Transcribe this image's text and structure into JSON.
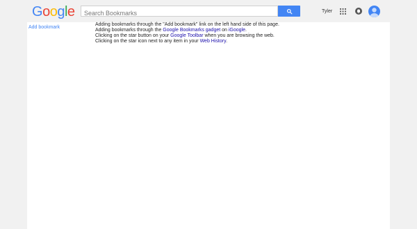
{
  "header": {
    "logo_letters": [
      {
        "ch": "G",
        "color": "#4285f4"
      },
      {
        "ch": "o",
        "color": "#ea4335"
      },
      {
        "ch": "o",
        "color": "#fbbc05"
      },
      {
        "ch": "g",
        "color": "#4285f4"
      },
      {
        "ch": "l",
        "color": "#34a853"
      },
      {
        "ch": "e",
        "color": "#ea4335"
      }
    ],
    "search_placeholder": "Search Bookmarks",
    "search_icon": "search-icon",
    "user_name": "Tyler",
    "apps_icon": "apps-grid-icon",
    "notifications_icon": "notifications-icon",
    "avatar_icon": "avatar-icon",
    "accent": "#4285f4"
  },
  "sidebar": {
    "add_bookmark": "Add bookmark"
  },
  "info": {
    "line1": "Adding bookmarks through the \"Add bookmark\" link on the left hand side of this page.",
    "line2_pre": "Adding bookmarks through the ",
    "line2_link1": "Google Bookmarks gadget",
    "line2_mid": " on ",
    "line2_link2": "iGoogle",
    "line2_post": ".",
    "line3_pre": "Clicking on the star button on your ",
    "line3_link": "Google Toolbar",
    "line3_post": " when you are browsing the web.",
    "line4_pre": "Clicking on the star icon next to any item in your ",
    "line4_link": "Web History",
    "line4_post": "."
  }
}
